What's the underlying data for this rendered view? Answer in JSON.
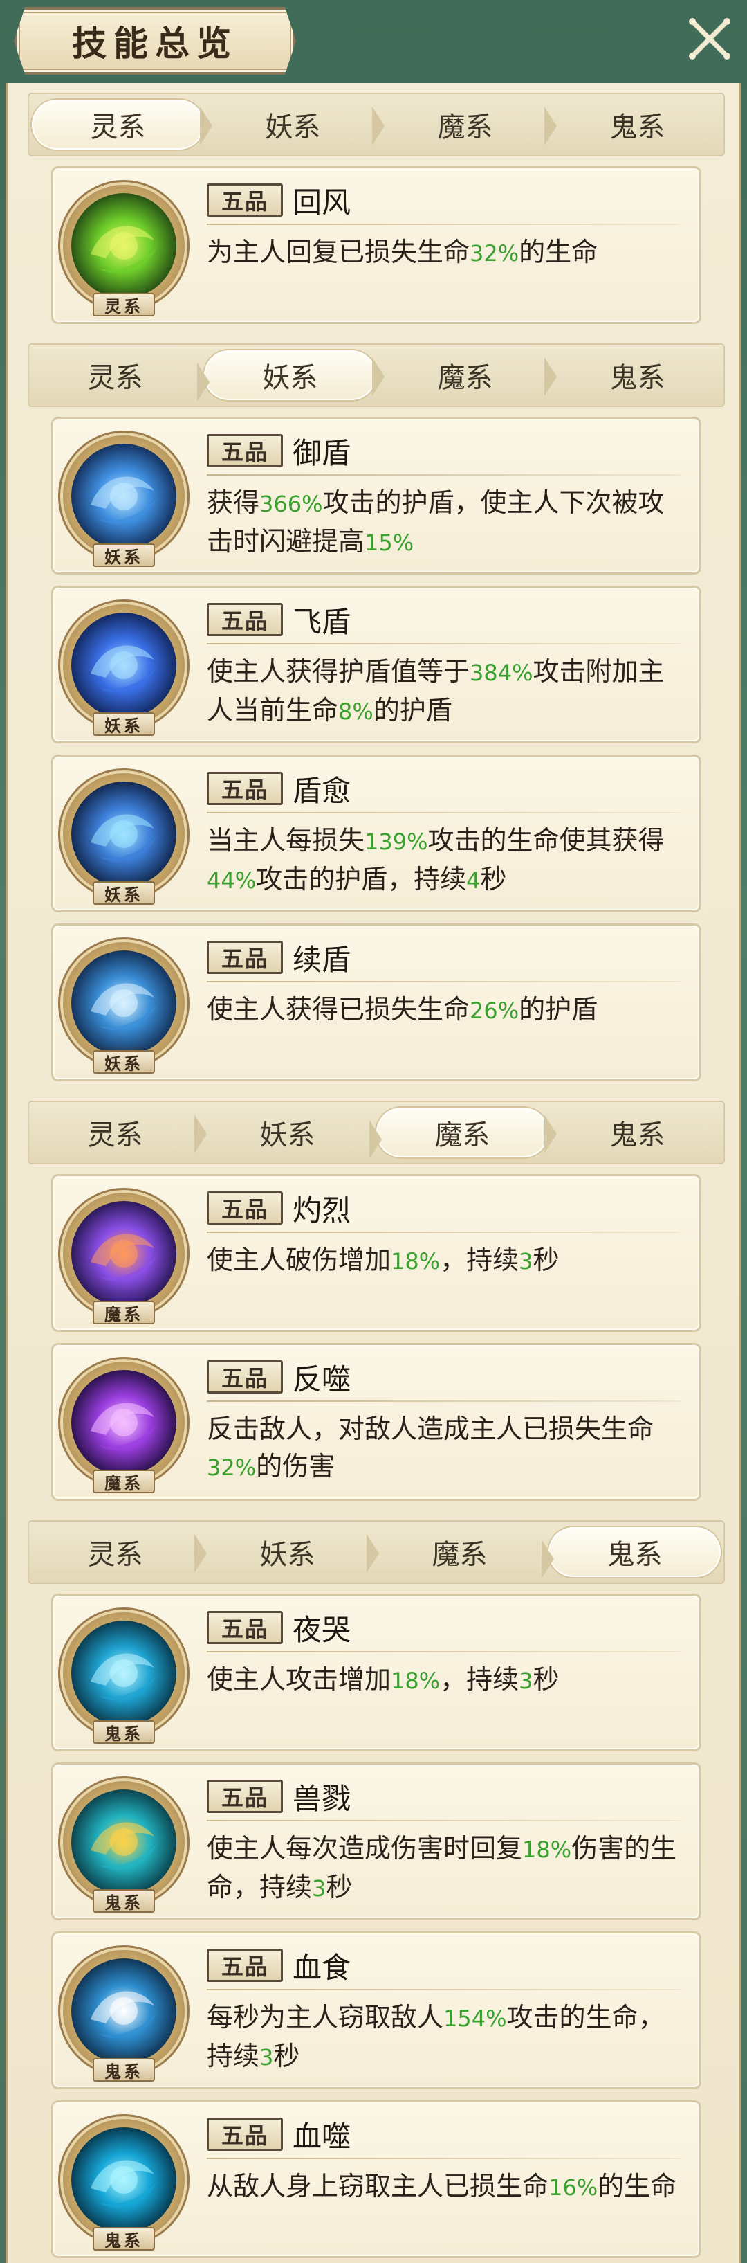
{
  "header": {
    "title": "技能总览",
    "close_icon": "close-x-icon"
  },
  "tab_labels": [
    "灵系",
    "妖系",
    "魔系",
    "鬼系"
  ],
  "grade_label": "五品",
  "sections": [
    {
      "active": "灵系",
      "skills": [
        {
          "element": "灵系",
          "name": "回风",
          "icon": "wind-swirl-icon",
          "desc": [
            {
              "t": "为主人回复已损失生命"
            },
            {
              "t": "32%",
              "hl": true
            },
            {
              "t": "的生命"
            }
          ]
        }
      ]
    },
    {
      "active": "妖系",
      "skills": [
        {
          "element": "妖系",
          "name": "御盾",
          "icon": "shield-icon",
          "desc": [
            {
              "t": "获得"
            },
            {
              "t": "366%",
              "hl": true
            },
            {
              "t": "攻击的护盾，使主人下次被攻击时闪避提高"
            },
            {
              "t": "15%",
              "hl": true
            }
          ]
        },
        {
          "element": "妖系",
          "name": "飞盾",
          "icon": "flying-shield-icon",
          "desc": [
            {
              "t": "使主人获得护盾值等于"
            },
            {
              "t": "384%",
              "hl": true
            },
            {
              "t": "攻击附加主人当前生命"
            },
            {
              "t": "8%",
              "hl": true
            },
            {
              "t": "的护盾"
            }
          ]
        },
        {
          "element": "妖系",
          "name": "盾愈",
          "icon": "vortex-icon",
          "desc": [
            {
              "t": "当主人每损失"
            },
            {
              "t": "139%",
              "hl": true
            },
            {
              "t": "攻击的生命使其获得"
            },
            {
              "t": "44%",
              "hl": true
            },
            {
              "t": "攻击的护盾，持续"
            },
            {
              "t": "4",
              "hl": true
            },
            {
              "t": "秒"
            }
          ]
        },
        {
          "element": "妖系",
          "name": "续盾",
          "icon": "beast-shield-icon",
          "desc": [
            {
              "t": "使主人获得已损失生命"
            },
            {
              "t": "26%",
              "hl": true
            },
            {
              "t": "的护盾"
            }
          ]
        }
      ]
    },
    {
      "active": "魔系",
      "skills": [
        {
          "element": "魔系",
          "name": "灼烈",
          "icon": "flame-vortex-icon",
          "desc": [
            {
              "t": "使主人破伤增加"
            },
            {
              "t": "18%",
              "hl": true
            },
            {
              "t": "，持续"
            },
            {
              "t": "3",
              "hl": true
            },
            {
              "t": "秒"
            }
          ]
        },
        {
          "element": "魔系",
          "name": "反噬",
          "icon": "dark-lotus-icon",
          "desc": [
            {
              "t": "反击敌人，对敌人造成主人已损失生命"
            },
            {
              "t": "32%",
              "hl": true
            },
            {
              "t": "的伤害"
            }
          ]
        }
      ]
    },
    {
      "active": "鬼系",
      "skills": [
        {
          "element": "鬼系",
          "name": "夜哭",
          "icon": "ghost-wisp-icon",
          "desc": [
            {
              "t": "使主人攻击增加"
            },
            {
              "t": "18%",
              "hl": true
            },
            {
              "t": "，持续"
            },
            {
              "t": "3",
              "hl": true
            },
            {
              "t": "秒"
            }
          ]
        },
        {
          "element": "鬼系",
          "name": "兽戮",
          "icon": "beast-fox-icon",
          "desc": [
            {
              "t": "使主人每次造成伤害时回复"
            },
            {
              "t": "18%",
              "hl": true
            },
            {
              "t": "伤害的生命，持续"
            },
            {
              "t": "3",
              "hl": true
            },
            {
              "t": "秒"
            }
          ]
        },
        {
          "element": "鬼系",
          "name": "血食",
          "icon": "spirit-bird-icon",
          "desc": [
            {
              "t": "每秒为主人窃取敌人"
            },
            {
              "t": "154%",
              "hl": true
            },
            {
              "t": "攻击的生命，持续"
            },
            {
              "t": "3",
              "hl": true
            },
            {
              "t": "秒"
            }
          ]
        },
        {
          "element": "鬼系",
          "name": "血噬",
          "icon": "wave-swirl-icon",
          "desc": [
            {
              "t": "从敌人身上窃取主人已损生命"
            },
            {
              "t": "16%",
              "hl": true
            },
            {
              "t": "的生命"
            }
          ]
        }
      ]
    }
  ],
  "colors": {
    "highlight": "#3aa030",
    "panel_bg": "#f3ecd6",
    "outer_bg": "#4f7d68"
  }
}
